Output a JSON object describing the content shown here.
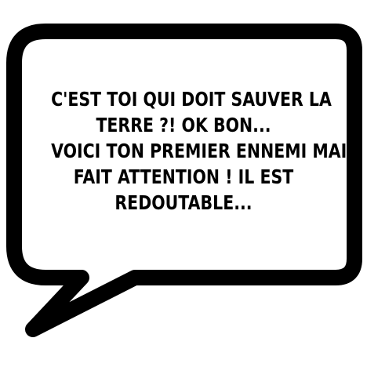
{
  "speech_bubble": {
    "lines": [
      "C'EST TOI QUI DOIT SAUVER LA",
      "TERRE ?! OK BON...",
      "VOICI TON PREMIER ENNEMI MAIS",
      "FAIT ATTENTION ! IL EST",
      "REDOUTABLE..."
    ],
    "fill_color": "#ffffff",
    "outline_color": "#000000",
    "text_color": "#000000"
  }
}
